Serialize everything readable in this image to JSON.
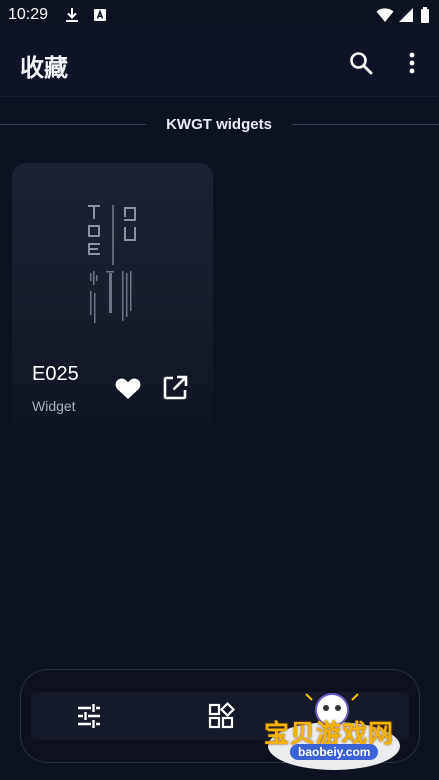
{
  "status_bar": {
    "time": "10:29",
    "icons": [
      "download-icon",
      "a-badge-icon",
      "wifi-icon",
      "signal-icon",
      "battery-icon"
    ]
  },
  "app_bar": {
    "title": "收藏",
    "actions": [
      "search-icon",
      "more-vert-icon"
    ]
  },
  "section": {
    "title": "KWGT widgets"
  },
  "widgets": [
    {
      "name": "E025",
      "type": "Widget",
      "preview_icon": "tue-widget-preview",
      "actions": [
        "favorite-icon",
        "open-external-icon"
      ]
    }
  ],
  "bottom_nav": {
    "items": [
      "tune-icon",
      "widgets-icon"
    ]
  },
  "watermark": {
    "text": "宝贝游戏网",
    "url_text": "baobeiy.com"
  },
  "colors": {
    "background": "#0e1322",
    "card": "#1a2030",
    "accent": "#ffffff",
    "muted": "#a9afbd"
  }
}
